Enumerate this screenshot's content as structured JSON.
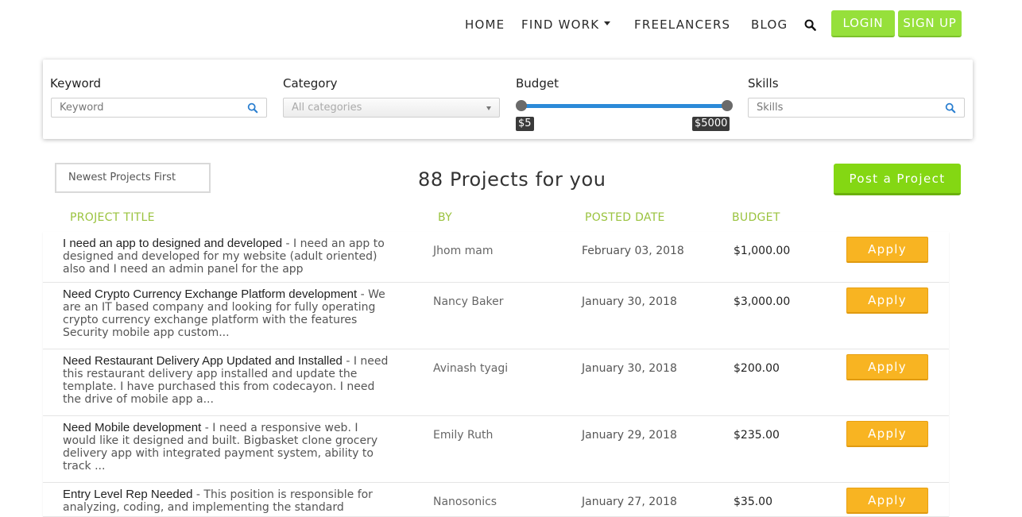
{
  "nav": {
    "home": "HOME",
    "find_work": "FIND WORK",
    "freelancers": "FREELANCERS",
    "blog": "BLOG",
    "login": "LOGIN",
    "signup": "SIGN UP"
  },
  "filters": {
    "keyword_label": "Keyword",
    "keyword_placeholder": "Keyword",
    "category_label": "Category",
    "category_value": "All categories",
    "budget_label": "Budget",
    "budget_min": "$5",
    "budget_max": "$5000",
    "skills_label": "Skills",
    "skills_placeholder": "Skills"
  },
  "list": {
    "sort_value": "Newest Projects First",
    "count_title": "88 Projects for you",
    "post_button": "Post a Project",
    "columns": {
      "title": "PROJECT TITLE",
      "by": "BY",
      "posted": "POSTED DATE",
      "budget": "BUDGET"
    },
    "apply_label": "Apply",
    "projects": [
      {
        "title": "I need an app to designed and developed",
        "desc": " - I need an app to designed and developed for my website (adult oriented) also and I need an admin panel for the app",
        "by": "Jhom mam",
        "date": "February 03, 2018",
        "budget": "$1,000.00"
      },
      {
        "title": "Need Crypto Currency Exchange Platform development",
        "desc": " - We are an IT based company and looking for fully operating crypto currency exchange platform with the features Security mobile app custom...",
        "by": "Nancy Baker",
        "date": "January 30, 2018",
        "budget": "$3,000.00"
      },
      {
        "title": "Need Restaurant Delivery App Updated and Installed",
        "desc": " - I need this restaurant delivery app installed and update the template. I have purchased this from codecayon. I need the drive of mobile app a...",
        "by": "Avinash tyagi",
        "date": "January 30, 2018",
        "budget": "$200.00"
      },
      {
        "title": "Need Mobile development",
        "desc": " - I need a responsive web. I would like it designed and built. Bigbasket clone grocery delivery app with integrated payment system, ability to track ...",
        "by": "Emily Ruth",
        "date": "January 29, 2018",
        "budget": "$235.00"
      },
      {
        "title": "Entry Level Rep Needed",
        "desc": " - This position is responsible for analyzing, coding, and implementing the standard",
        "by": "Nanosonics",
        "date": "January 27, 2018",
        "budget": "$35.00"
      }
    ]
  },
  "colors": {
    "login_green": "#96e03b",
    "post_green": "#84d713",
    "apply_orange": "#f8b422",
    "header_green": "#9ac33e",
    "slider_blue": "#2b8ad8"
  },
  "icons": {
    "nav_search": "search-icon",
    "keyword_search": "search-icon",
    "skills_search": "search-icon",
    "find_work_caret": "caret-down-icon",
    "category_arrow": "chevron-down-icon"
  }
}
